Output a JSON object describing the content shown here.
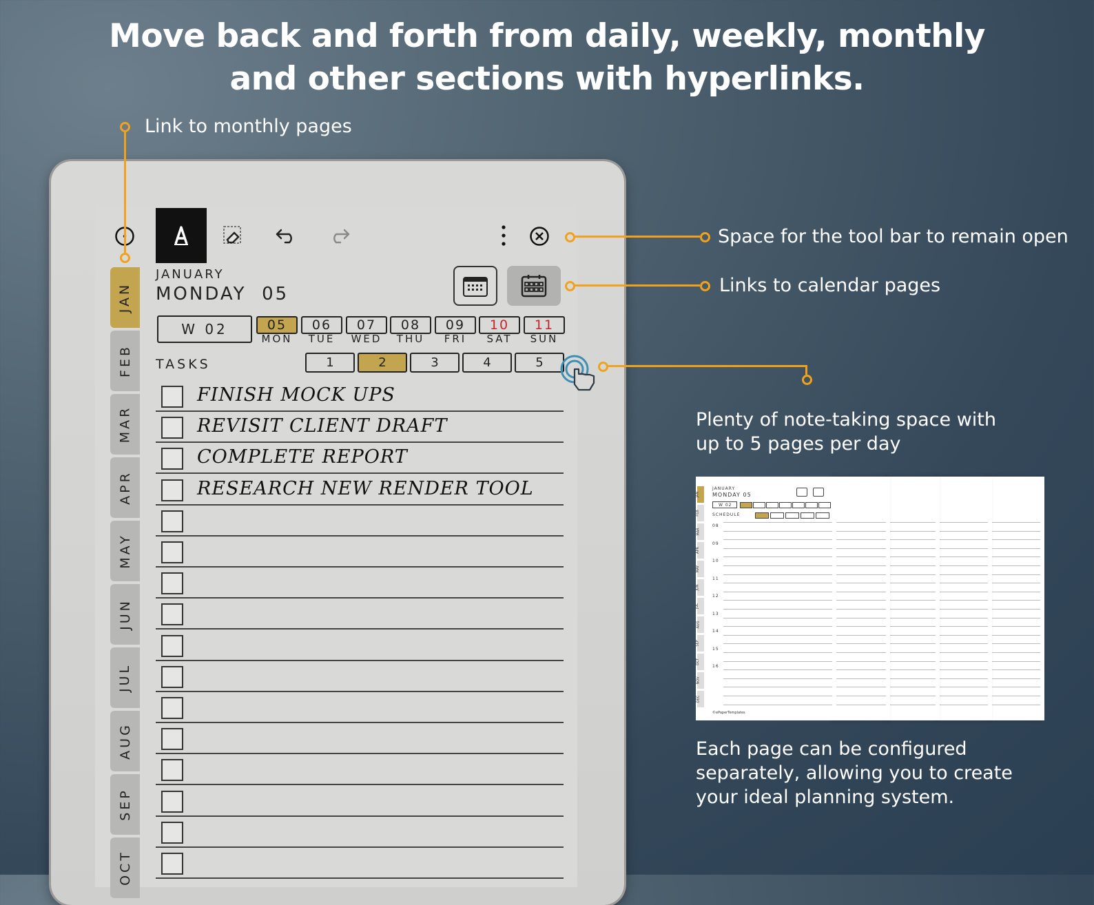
{
  "headline": {
    "line1": "Move back and forth from daily, weekly, monthly",
    "line2": "and other sections with hyperlinks."
  },
  "callouts": {
    "monthly_link": "Link to monthly pages",
    "toolbar_space": "Space for the tool bar to remain open",
    "calendar_links": "Links to calendar pages",
    "note_space_line1": "Plenty of note-taking space with",
    "note_space_line2": "up to 5 pages per day",
    "configure_line1": "Each page can be configured",
    "configure_line2": "separately, allowing you to create",
    "configure_line3": "your ideal planning system."
  },
  "toolbar": {
    "icons": [
      "toggle-icon",
      "pen-icon",
      "eraser-icon",
      "undo-icon",
      "redo-icon",
      "more-icon",
      "close-icon"
    ]
  },
  "planner": {
    "month": "JANUARY",
    "day_title": "MONDAY  05",
    "week": "W 02",
    "days": [
      {
        "num": "05",
        "name": "MON",
        "active": true,
        "weekend": false
      },
      {
        "num": "06",
        "name": "TUE",
        "active": false,
        "weekend": false
      },
      {
        "num": "07",
        "name": "WED",
        "active": false,
        "weekend": false
      },
      {
        "num": "08",
        "name": "THU",
        "active": false,
        "weekend": false
      },
      {
        "num": "09",
        "name": "FRI",
        "active": false,
        "weekend": false
      },
      {
        "num": "10",
        "name": "SAT",
        "active": false,
        "weekend": true
      },
      {
        "num": "11",
        "name": "SUN",
        "active": false,
        "weekend": true
      }
    ],
    "tasks_label": "TASKS",
    "pages": [
      "1",
      "2",
      "3",
      "4",
      "5"
    ],
    "active_page": "2",
    "tasks": [
      "Finish mock ups",
      "Revisit client draft",
      "Complete report",
      "Research new render tool",
      "",
      "",
      "",
      "",
      "",
      "",
      "",
      "",
      "",
      "",
      "",
      ""
    ],
    "month_tabs": [
      "JAN",
      "FEB",
      "MAR",
      "APR",
      "MAY",
      "JUN",
      "JUL",
      "AUG",
      "SEP",
      "OCT"
    ],
    "active_month": "JAN"
  },
  "thumbnail": {
    "month": "JANUARY",
    "day_title": "MONDAY 05",
    "week": "W 02",
    "schedule_label": "SCHEDULE",
    "hours": [
      "08",
      "09",
      "10",
      "11",
      "12",
      "13",
      "14",
      "15",
      "16"
    ],
    "months": [
      "JAN",
      "FEB",
      "MAR",
      "APR",
      "MAY",
      "JUN",
      "JUL",
      "AUG",
      "SEP",
      "OCT",
      "NOV",
      "DEC"
    ],
    "footer": "©ePaperTemplates"
  },
  "colors": {
    "accent": "#f0a21c",
    "gold": "#c3a44f",
    "weekend": "#c4262b"
  }
}
